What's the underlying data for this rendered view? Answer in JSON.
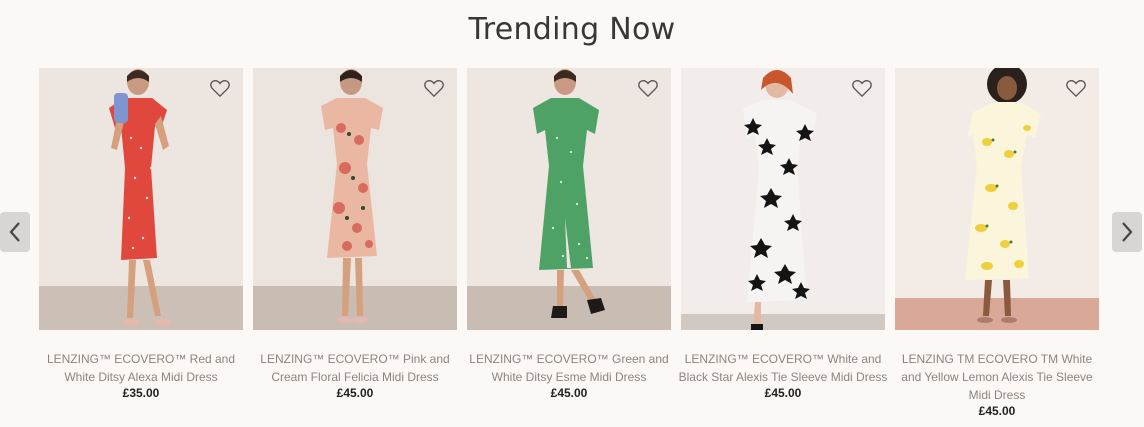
{
  "section": {
    "title": "Trending Now"
  },
  "carousel": {
    "prev_icon": "chevron-left-icon",
    "next_icon": "chevron-right-icon"
  },
  "colors": {
    "background": "#fcf8f5",
    "title": "#3a3633",
    "name_text": "#8c8480",
    "price_text": "#222222",
    "arrow_bg": "#d9d5d3"
  },
  "products": [
    {
      "name": "LENZING™ ECOVERO™ Red and White Ditsy Alexa Midi Dress",
      "price": "£35.00",
      "wishlist_icon": "heart-outline-icon"
    },
    {
      "name": "LENZING™ ECOVERO™ Pink and Cream Floral Felicia Midi Dress",
      "price": "£45.00",
      "wishlist_icon": "heart-outline-icon"
    },
    {
      "name": "LENZING™ ECOVERO™ Green and White Ditsy Esme Midi Dress",
      "price": "£45.00",
      "wishlist_icon": "heart-outline-icon"
    },
    {
      "name": "LENZING™ ECOVERO™ White and Black Star Alexis Tie Sleeve Midi Dress",
      "price": "£45.00",
      "wishlist_icon": "heart-outline-icon"
    },
    {
      "name": "LENZING TM ECOVERO TM White and Yellow Lemon Alexis Tie Sleeve Midi Dress",
      "price": "£45.00",
      "wishlist_icon": "heart-outline-icon"
    }
  ]
}
